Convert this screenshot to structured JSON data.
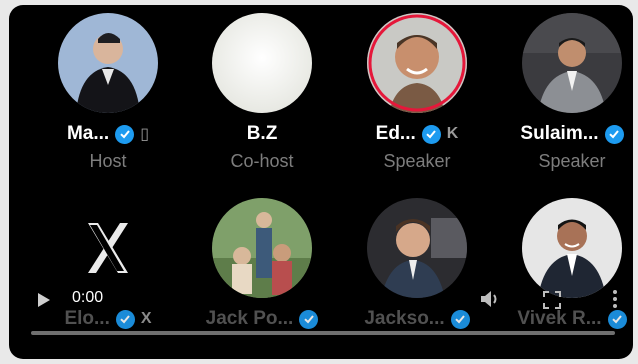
{
  "player": {
    "time": "0:00",
    "progress": 0.0,
    "icons": [
      "play-icon",
      "volume-icon",
      "fullscreen-icon",
      "more-options-icon"
    ]
  },
  "participants": [
    {
      "name": "Ma...",
      "role": "Host",
      "verified": true,
      "affiliate": "▯",
      "ring": false,
      "avatar": "photo-man-dark-suit"
    },
    {
      "name": "B.Z",
      "role": "Co-host",
      "verified": false,
      "affiliate": "",
      "ring": false,
      "avatar": "white-blank"
    },
    {
      "name": "Ed...",
      "role": "Speaker",
      "verified": true,
      "affiliate": "K",
      "ring": true,
      "avatar": "photo-man-smiling"
    },
    {
      "name": "Sulaim...",
      "role": "Speaker",
      "verified": true,
      "affiliate": "",
      "ring": false,
      "avatar": "photo-man-grey-suit"
    },
    {
      "name": "Elo...",
      "role": "",
      "verified": true,
      "affiliate": "X",
      "ring": false,
      "avatar": "x-logo"
    },
    {
      "name": "Jack Po...",
      "role": "",
      "verified": true,
      "affiliate": "",
      "ring": false,
      "avatar": "photo-family-outdoors"
    },
    {
      "name": "Jackso...",
      "role": "",
      "verified": true,
      "affiliate": "",
      "ring": false,
      "avatar": "photo-man-blazer"
    },
    {
      "name": "Vivek R...",
      "role": "",
      "verified": true,
      "affiliate": "",
      "ring": false,
      "avatar": "photo-man-smiling-suit"
    }
  ],
  "colors": {
    "verified": "#1d9bf0",
    "speaking_ring": "#e5173a",
    "role_text": "#7d7d7d"
  }
}
